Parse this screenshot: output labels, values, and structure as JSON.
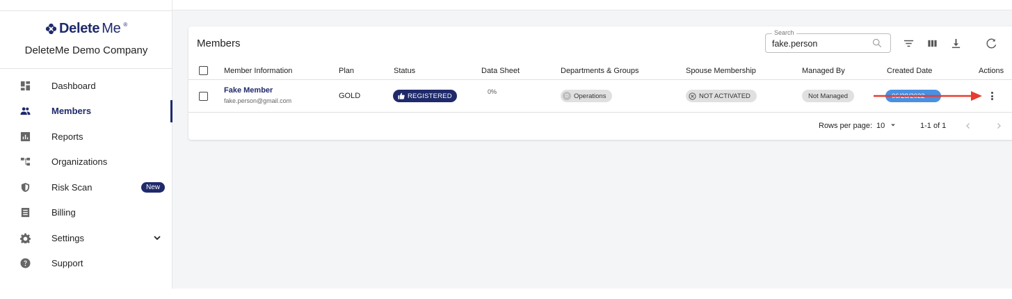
{
  "brand": {
    "logo_text_bold": "Delete",
    "logo_text_light": "Me",
    "logo_mark": "®",
    "company_name": "DeleteMe Demo Company"
  },
  "sidebar": {
    "items": [
      {
        "label": "Dashboard",
        "icon": "dashboard-icon"
      },
      {
        "label": "Members",
        "icon": "members-icon",
        "active": true
      },
      {
        "label": "Reports",
        "icon": "reports-icon"
      },
      {
        "label": "Organizations",
        "icon": "organizations-icon"
      },
      {
        "label": "Risk Scan",
        "icon": "shield-icon",
        "badge": "New"
      },
      {
        "label": "Billing",
        "icon": "billing-icon"
      },
      {
        "label": "Settings",
        "icon": "gear-icon",
        "expandable": true
      },
      {
        "label": "Support",
        "icon": "help-icon"
      }
    ]
  },
  "members": {
    "title": "Members",
    "search": {
      "label": "Search",
      "value": "fake.person"
    },
    "toolbar": [
      "filter-icon",
      "columns-icon",
      "download-icon",
      "refresh-icon"
    ],
    "columns": [
      "Member Information",
      "Plan",
      "Status",
      "Data Sheet",
      "Departments & Groups",
      "Spouse Membership",
      "Managed By",
      "Created Date",
      "Actions"
    ],
    "rows": [
      {
        "name": "Fake Member",
        "email": "fake.person@gmail.com",
        "plan": "GOLD",
        "status": "REGISTERED",
        "data_sheet": "0%",
        "department_initial": "D",
        "department": "Operations",
        "spouse": "NOT ACTIVATED",
        "managed_by": "Not Managed",
        "created_date": "06/28/2022"
      }
    ],
    "pagination": {
      "rows_per_page_label": "Rows per page:",
      "rows_per_page": "10",
      "range": "1-1 of 1"
    }
  },
  "colors": {
    "brand": "#1f2a6b",
    "annotation_arrow": "#e53d2f",
    "date_chip": "#4a90e2"
  }
}
